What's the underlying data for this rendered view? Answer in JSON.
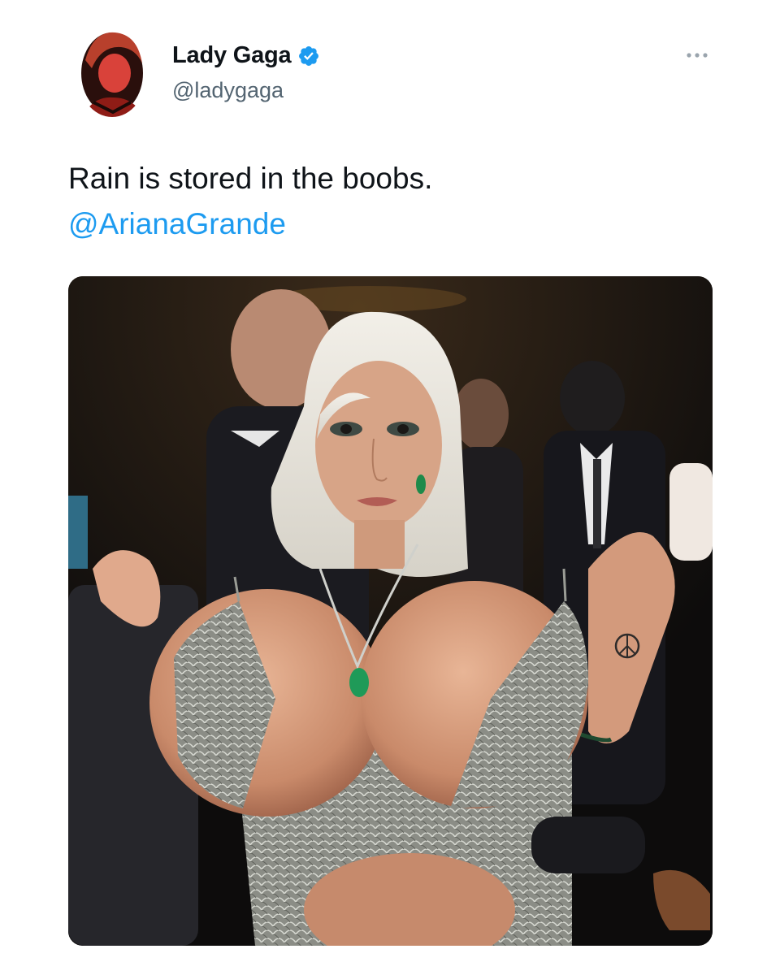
{
  "tweet": {
    "author": {
      "display_name": "Lady Gaga",
      "handle": "@ladygaga",
      "verified": true,
      "avatar_icon": "profile-photo"
    },
    "more_icon": "more-options-icon",
    "text": "Rain is stored in the boobs.",
    "mention": "@ArianaGrande",
    "colors": {
      "text": "#0f1419",
      "handle": "#536471",
      "link": "#1d9bf0",
      "verified_badge": "#1d9bf0"
    },
    "media": {
      "kind": "photo"
    }
  }
}
